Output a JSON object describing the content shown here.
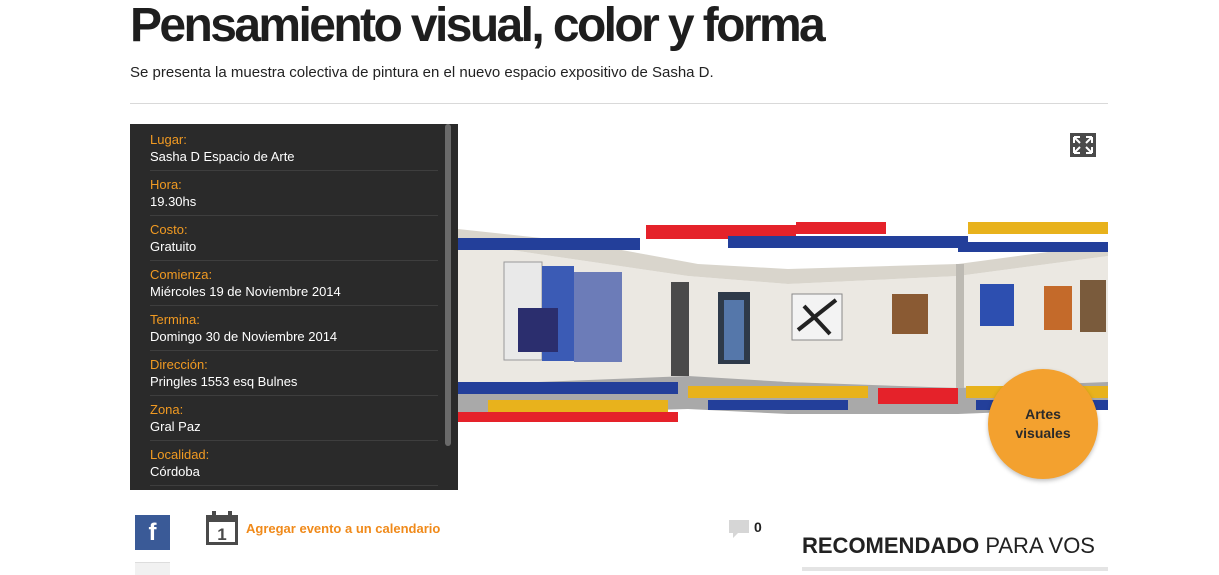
{
  "event": {
    "title": "Pensamiento visual, color y forma",
    "subtitle": "Se presenta la muestra colectiva de pintura en el nuevo espacio expositivo de Sasha D."
  },
  "details": [
    {
      "label": "Lugar:",
      "value": "Sasha D Espacio de Arte"
    },
    {
      "label": "Hora:",
      "value": "19.30hs"
    },
    {
      "label": "Costo:",
      "value": "Gratuito"
    },
    {
      "label": "Comienza:",
      "value": "Miércoles 19 de Noviembre 2014"
    },
    {
      "label": "Termina:",
      "value": "Domingo 30 de Noviembre 2014"
    },
    {
      "label": "Dirección:",
      "value": "Pringles 1553 esq Bulnes"
    },
    {
      "label": "Zona:",
      "value": "Gral Paz"
    },
    {
      "label": "Localidad:",
      "value": "Córdoba"
    }
  ],
  "category_badge": "Artes visuales",
  "actions": {
    "facebook_letter": "f",
    "calendar_day": "1",
    "add_to_calendar": "Agregar evento a un calendario",
    "comment_count": "0"
  },
  "recommended": {
    "bold": "RECOMENDADO",
    "rest": " PARA VOS"
  },
  "colors": {
    "accent_orange": "#f19a22",
    "panel_bg": "#2a2a2a",
    "facebook_blue": "#3a5a97",
    "stripe_red": "#e5222a",
    "stripe_blue": "#233f9a",
    "stripe_yellow": "#e8b21c"
  },
  "icons": [
    "expand-icon",
    "facebook-icon",
    "calendar-icon",
    "comment-icon"
  ]
}
